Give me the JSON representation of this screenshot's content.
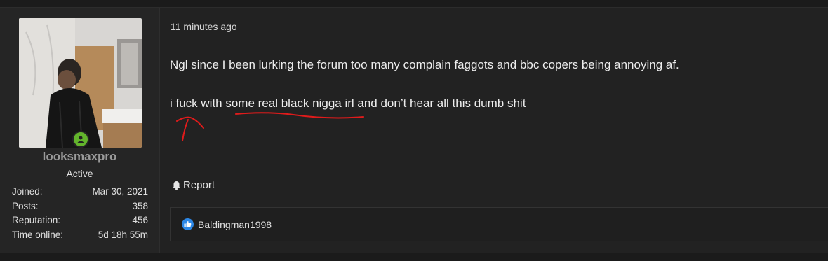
{
  "user": {
    "username": "looksmaxpro",
    "title": "Active",
    "stats": [
      {
        "label": "Joined:",
        "value": "Mar 30, 2021"
      },
      {
        "label": "Posts:",
        "value": "358"
      },
      {
        "label": "Reputation:",
        "value": "456"
      },
      {
        "label": "Time online:",
        "value": "5d 18h 55m"
      }
    ],
    "online_color": "#63b42c"
  },
  "post": {
    "timestamp": "11 minutes ago",
    "paragraphs": [
      "Ngl since I been lurking the forum too many complain faggots and bbc copers being annoying af.",
      "i fuck with some real black nigga irl and don’t hear all this dumb shit"
    ],
    "report_label": "Report",
    "reactions": {
      "names": "Baldingman1998",
      "like_color": "#2c88e8"
    }
  },
  "annotation_color": "#e01b1b"
}
